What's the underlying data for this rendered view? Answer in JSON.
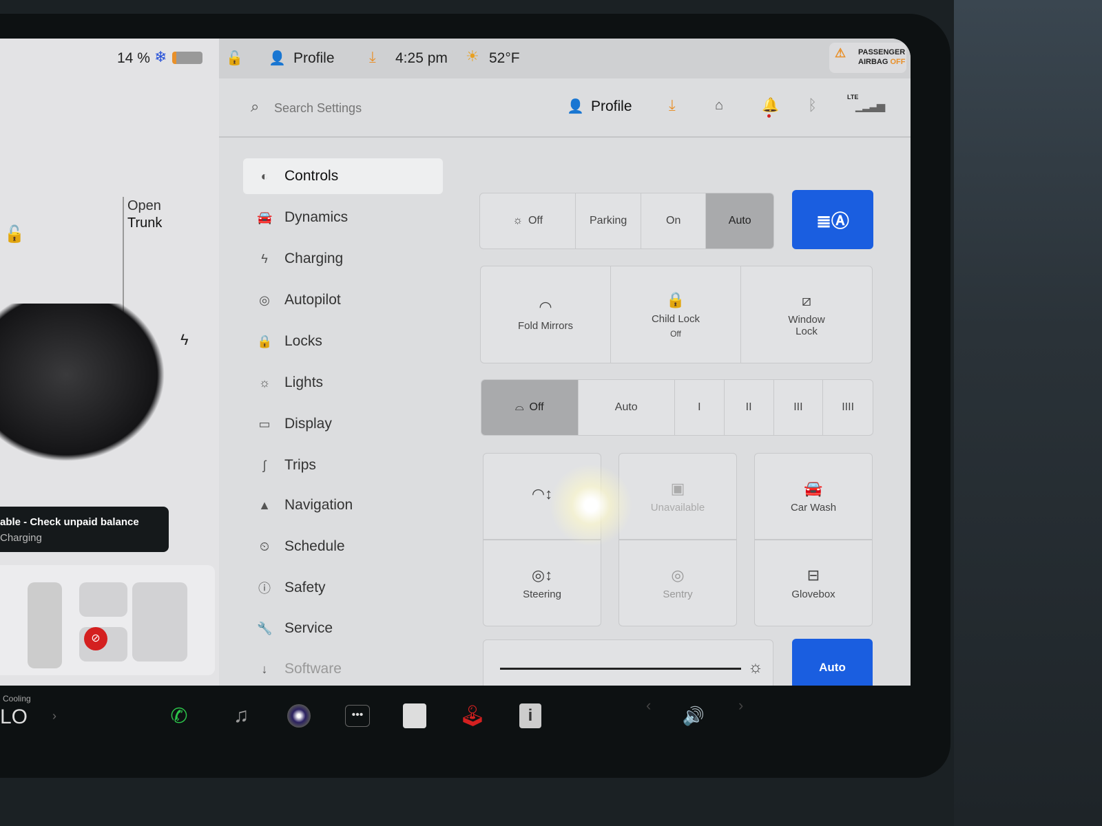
{
  "status_bar": {
    "battery": "14 %",
    "profile": "Profile",
    "time": "4:25 pm",
    "temperature": "52°F",
    "airbag_line1": "PASSENGER",
    "airbag_line2": "AIRBAG",
    "airbag_state": "OFF"
  },
  "car_panel": {
    "open_trunk_1": "Open",
    "open_trunk_2": "Trunk",
    "notice_title": "able - Check unpaid balance",
    "notice_sub": "Charging"
  },
  "header": {
    "search_placeholder": "Search Settings",
    "profile": "Profile",
    "lte": "LTE"
  },
  "menu": [
    {
      "label": "Controls",
      "icon": "toggle"
    },
    {
      "label": "Dynamics",
      "icon": "car"
    },
    {
      "label": "Charging",
      "icon": "bolt"
    },
    {
      "label": "Autopilot",
      "icon": "steering-wheel"
    },
    {
      "label": "Locks",
      "icon": "lock"
    },
    {
      "label": "Lights",
      "icon": "sun"
    },
    {
      "label": "Display",
      "icon": "display"
    },
    {
      "label": "Trips",
      "icon": "trips"
    },
    {
      "label": "Navigation",
      "icon": "arrow"
    },
    {
      "label": "Schedule",
      "icon": "clock"
    },
    {
      "label": "Safety",
      "icon": "alert"
    },
    {
      "label": "Service",
      "icon": "wrench"
    },
    {
      "label": "Software",
      "icon": "download"
    }
  ],
  "lights": {
    "options": [
      "Off",
      "Parking",
      "On",
      "Auto"
    ],
    "selected": "Auto"
  },
  "tiles1": [
    {
      "label": "Fold Mirrors"
    },
    {
      "label": "Child Lock",
      "sub": "Off"
    },
    {
      "label": "Window Lock"
    }
  ],
  "wipers": {
    "options": [
      "Off",
      "Auto",
      "I",
      "II",
      "III",
      "IIII"
    ],
    "selected": "Off"
  },
  "tiles2": [
    {
      "label": ""
    },
    {
      "label": "Unavailable"
    },
    {
      "label": "Car Wash"
    },
    {
      "label": "Steering"
    },
    {
      "label": "Sentry"
    },
    {
      "label": "Glovebox"
    }
  ],
  "brightness": {
    "auto_label": "Auto",
    "level": 1.0
  },
  "dock": {
    "climate_label": "Cooling",
    "climate_value": "LO"
  },
  "colors": {
    "accent": "#1a5ee0",
    "warning": "#e8902a",
    "alert": "#d42020"
  }
}
